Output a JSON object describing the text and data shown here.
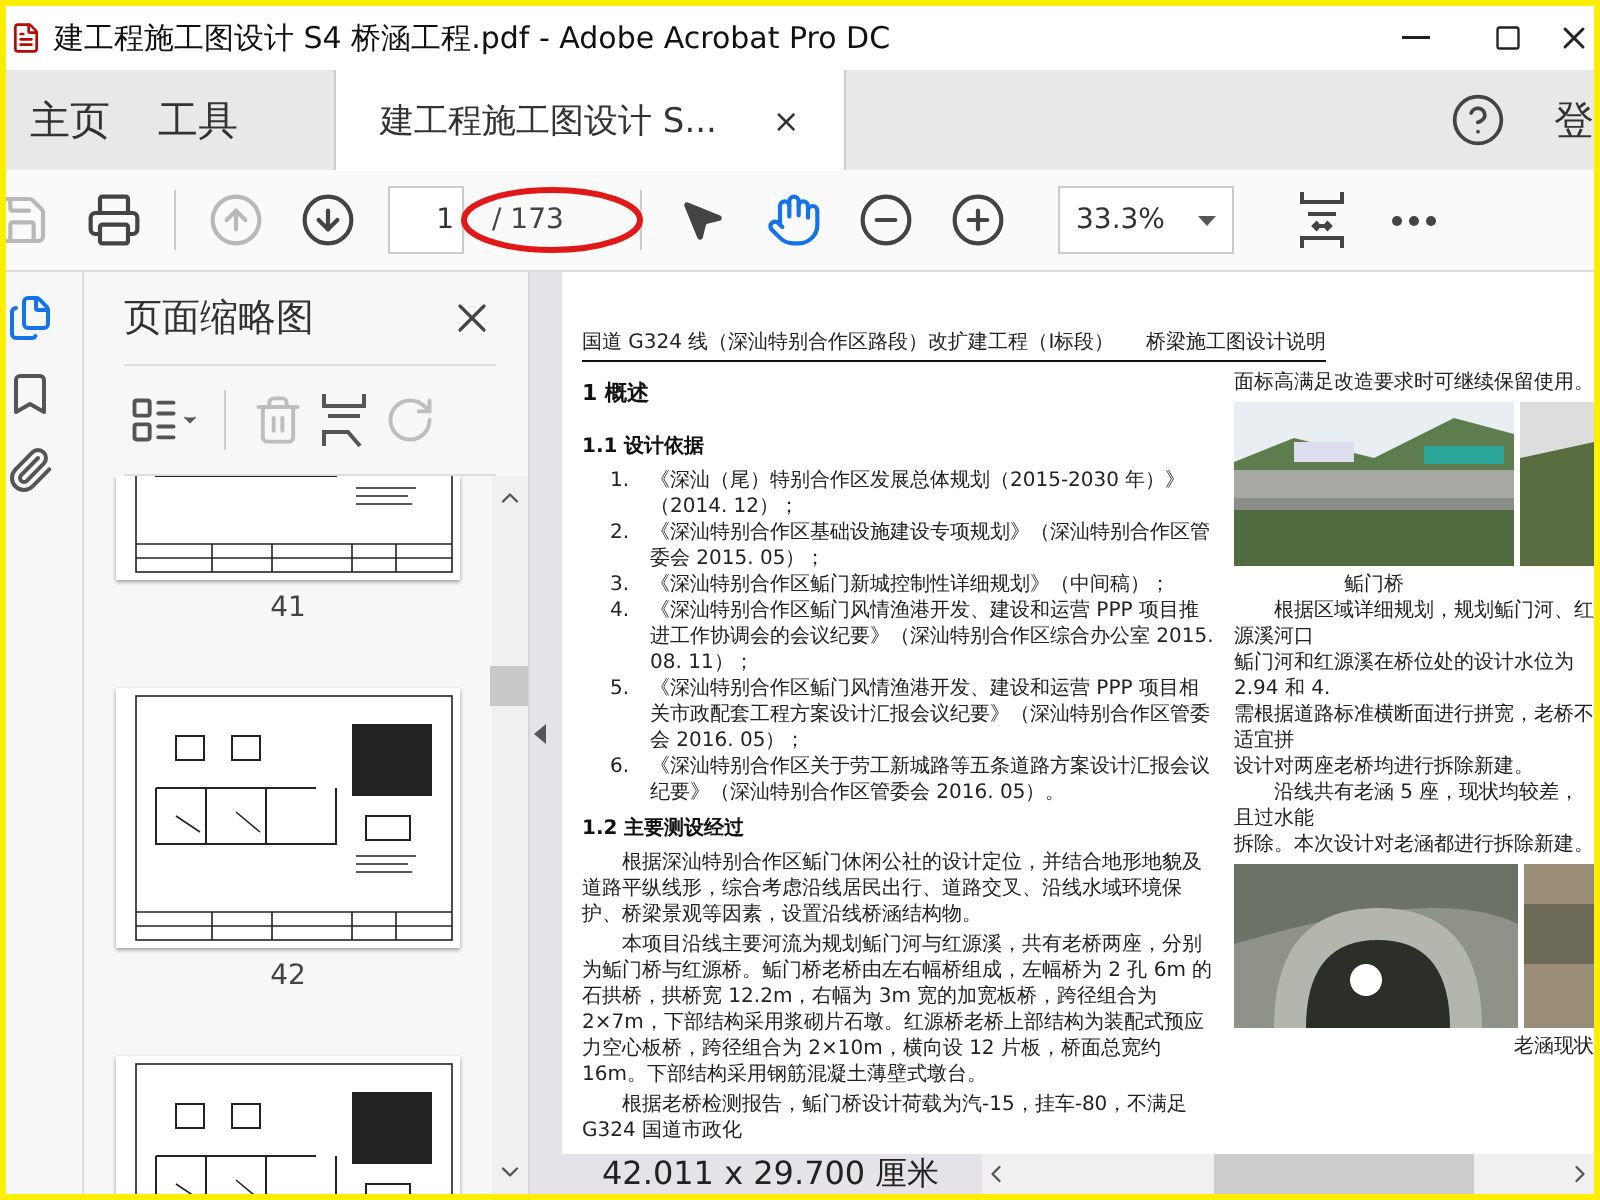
{
  "window": {
    "title": "建工程施工图设计 S4 桥涵工程.pdf - Adobe Acrobat Pro DC"
  },
  "tabs": [
    {
      "label": "主页",
      "selected": false,
      "kind": "nav"
    },
    {
      "label": "工具",
      "selected": false,
      "kind": "nav"
    },
    {
      "label": "建工程施工图设计 S...",
      "selected": true,
      "kind": "document",
      "close": "×"
    }
  ],
  "account": "登",
  "toolbar": [
    {
      "kind": "save",
      "disabled": true
    },
    {
      "kind": "print",
      "disabled": false
    },
    {
      "kind": "prev",
      "disabled": true
    },
    {
      "kind": "next",
      "disabled": false
    },
    {
      "kind": "page",
      "value": "1",
      "total": "/ 173"
    },
    {
      "kind": "select",
      "selected": false
    },
    {
      "kind": "hand",
      "selected": true
    },
    {
      "kind": "zoom-out",
      "disabled": false
    },
    {
      "kind": "zoom-in",
      "disabled": false
    },
    {
      "kind": "zoom",
      "value": "33.3%"
    },
    {
      "kind": "fit",
      "disabled": false
    },
    {
      "kind": "more",
      "disabled": false
    }
  ],
  "nav_rail": [
    {
      "kind": "pages",
      "selected": true
    },
    {
      "kind": "bookmarks",
      "selected": false
    },
    {
      "kind": "attachments",
      "selected": false
    }
  ],
  "thumbnails": {
    "title": "页面缩略图",
    "tools": [
      {
        "kind": "options",
        "disabled": false
      },
      {
        "kind": "delete",
        "disabled": true
      },
      {
        "kind": "insert",
        "disabled": false
      },
      {
        "kind": "undo",
        "disabled": true
      }
    ],
    "pages": [
      {
        "kind": "bottom-part",
        "label": "41"
      },
      {
        "kind": "whole",
        "label": "42"
      },
      {
        "kind": "top-part"
      }
    ]
  },
  "document": {
    "header_left": "国道 G324 线（深汕特别合作区路段）改扩建工程（Ⅰ标段）",
    "header_right": "桥梁施工图设计说明",
    "left": [
      {
        "kind": "h1",
        "text": "1 概述"
      },
      {
        "kind": "h2",
        "text": "1.1 设计依据"
      },
      {
        "kind": "item",
        "number": "1.",
        "text": "《深汕（尾）特别合作区发展总体规划（2015-2030 年）》（2014. 12）；"
      },
      {
        "kind": "item",
        "number": "2.",
        "text": "《深汕特别合作区基础设施建设专项规划》（深汕特别合作区管委会 2015. 05）；"
      },
      {
        "kind": "item",
        "number": "3.",
        "text": "《深汕特别合作区鲘门新城控制性详细规划》（中间稿）；"
      },
      {
        "kind": "item",
        "number": "4.",
        "text": "《深汕特别合作区鲘门风情渔港开发、建设和运营 PPP 项目推进工作协调会的会议纪要》（深汕特别合作区综合办公室 2015. 08. 11）；"
      },
      {
        "kind": "item",
        "number": "5.",
        "text": "《深汕特别合作区鲘门风情渔港开发、建设和运营 PPP 项目相关市政配套工程方案设计汇报会议纪要》（深汕特别合作区管委会 2016. 05）；"
      },
      {
        "kind": "item",
        "number": "6.",
        "text": "《深汕特别合作区关于劳工新城路等五条道路方案设计汇报会议纪要》（深汕特别合作区管委会 2016. 05）。"
      },
      {
        "kind": "h2",
        "text": "1.2 主要测设经过"
      },
      {
        "kind": "para",
        "text": "根据深汕特别合作区鲘门休闲公社的设计定位，并结合地形地貌及道路平纵线形，综合考虑沿线居民出行、道路交叉、沿线水域环境保护、桥梁景观等因素，设置沿线桥涵结构物。"
      },
      {
        "kind": "para",
        "text": "本项目沿线主要河流为规划鲘门河与红源溪，共有老桥两座，分别为鲘门桥与红源桥。鲘门桥老桥由左右幅桥组成，左幅桥为 2 孔 6m 的石拱桥，拱桥宽 12.2m，右幅为 3m 宽的加宽板桥，跨径组合为 2×7m，下部结构采用浆砌片石墩。红源桥老桥上部结构为装配式预应力空心板桥，跨径组合为 2×10m，横向设 12 片板，桥面总宽约 16m。下部结构采用钢筋混凝土薄壁式墩台。"
      },
      {
        "kind": "para",
        "text": "根据老桥检测报告，鲘门桥设计荷载为汽-15，挂车-80，不满足 G324 国道市政化"
      }
    ],
    "right": [
      {
        "kind": "line",
        "text": "面标高满足改造要求时可继续保留使用。"
      },
      {
        "kind": "picture"
      },
      {
        "kind": "caption",
        "text": "鲘门桥"
      },
      {
        "kind": "indent-line",
        "text": "根据区域详细规划，规划鲘门河、红源溪河口"
      },
      {
        "kind": "line",
        "text": "鲘门河和红源溪在桥位处的设计水位为 2.94 和 4."
      },
      {
        "kind": "line",
        "text": "需根据道路标准横断面进行拼宽，老桥不适宜拼"
      },
      {
        "kind": "line",
        "text": "设计对两座老桥均进行拆除新建。"
      },
      {
        "kind": "indent-line",
        "text": "沿线共有老涵 5 座，现状均较差，且过水能"
      },
      {
        "kind": "line",
        "text": "拆除。本次设计对老涵都进行拆除新建。"
      },
      {
        "kind": "picture"
      },
      {
        "kind": "caption-right",
        "text": "老涵现状"
      }
    ]
  },
  "status_bar": {
    "page_size": "42.011 x 29.700 厘米"
  }
}
